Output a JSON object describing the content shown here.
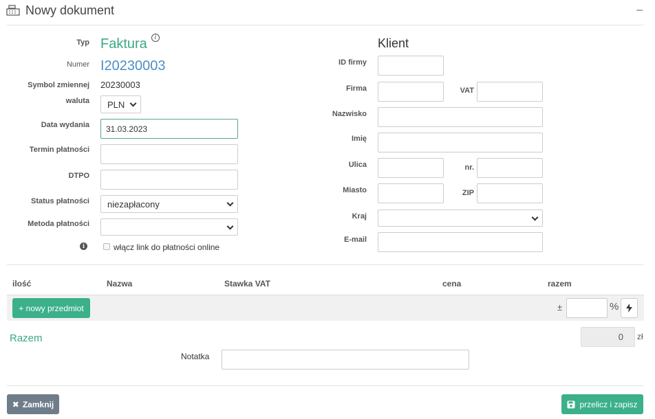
{
  "header": {
    "title": "Nowy dokument",
    "minimize": "–"
  },
  "left": {
    "typ_label": "Typ",
    "typ_value": "Faktura",
    "numer_label": "Numer",
    "numer_value": "I20230003",
    "symbol_label": "Symbol zmiennej",
    "symbol_value": "20230003",
    "waluta_label": "waluta",
    "waluta_value": "PLN",
    "data_label": "Data wydania",
    "data_value": "31.03.2023",
    "termin_label": "Termin płatności",
    "termin_value": "",
    "dtpo_label": "DTPO",
    "dtpo_value": "",
    "status_label": "Status płatności",
    "status_value": "niezapłacony",
    "metoda_label": "Metoda płatności",
    "metoda_value": "",
    "online_label": "włącz link do płatności online"
  },
  "right": {
    "klient_title": "Klient",
    "id_firmy_label": "ID firmy",
    "firma_label": "Firma",
    "vat_label": "VAT",
    "nazwisko_label": "Nazwisko",
    "imie_label": "Imię",
    "ulica_label": "Ulica",
    "nr_label": "nr.",
    "miasto_label": "Miasto",
    "zip_label": "ZIP",
    "kraj_label": "Kraj",
    "email_label": "E-mail"
  },
  "items_table": {
    "columns": [
      "ilość",
      "Nazwa",
      "Stawka VAT",
      "cena",
      "razem"
    ],
    "add_item_button": "+ nowy przedmiot",
    "plusminus": "±",
    "percent_value": "",
    "percent_sign": "%"
  },
  "totals": {
    "razem_label": "Razem",
    "total_value": "0",
    "currency": "zł",
    "notatka_label": "Notatka",
    "notatka_value": ""
  },
  "footer": {
    "close_button": "Zamknij",
    "save_button": "przelicz i zapisz"
  },
  "colors": {
    "accent_green": "#3bb08a",
    "number_blue": "#4a8fc7",
    "close_gray": "#6f7d8a"
  }
}
